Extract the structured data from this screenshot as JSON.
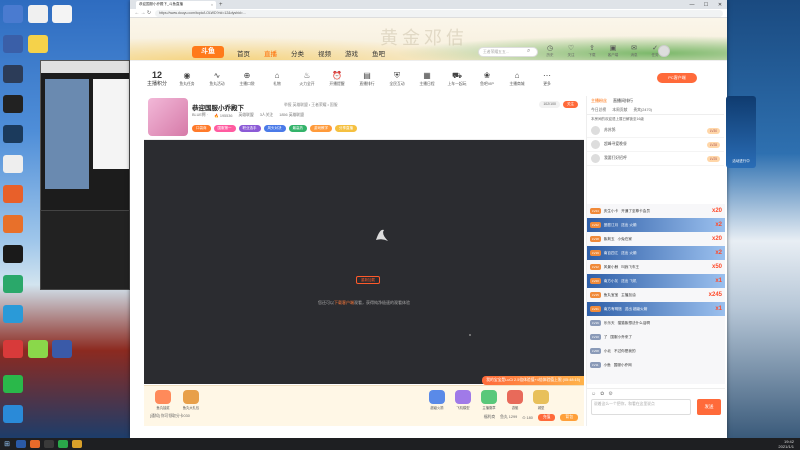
{
  "browser": {
    "tab_title": "恭迎国服小乔殿下_斗鱼直播",
    "url": "https://www.douyu.com/topic/LOLWD?rid=12&dyshid=...",
    "win_min": "—",
    "win_max": "☐",
    "win_close": "✕"
  },
  "site": {
    "watermark": "黄金邓佶",
    "logo": "斗鱼",
    "nav": [
      "首页",
      "直播",
      "分类",
      "视频",
      "游戏",
      "鱼吧"
    ],
    "nav_active_index": 1,
    "search_placeholder": "王者荣耀五五...",
    "header_icons": [
      {
        "icon": "history-icon",
        "glyph": "◷",
        "label": "历史"
      },
      {
        "icon": "follow-icon",
        "glyph": "♡",
        "label": "关注"
      },
      {
        "icon": "upload-icon",
        "glyph": "⇪",
        "label": "下载"
      },
      {
        "icon": "app-icon",
        "glyph": "▣",
        "label": "客户端"
      },
      {
        "icon": "message-icon",
        "glyph": "✉",
        "label": "消息"
      },
      {
        "icon": "task-icon",
        "glyph": "✓",
        "label": "任务"
      }
    ]
  },
  "categories": {
    "first_value": "12",
    "first_label": "主播积分",
    "items": [
      {
        "icon": "game-icon",
        "glyph": "◉",
        "label": "鱼丸任务"
      },
      {
        "icon": "pulse-icon",
        "glyph": "∿",
        "label": "鱼丸活动"
      },
      {
        "icon": "capsule-icon",
        "glyph": "⊕",
        "label": "主播口袋"
      },
      {
        "icon": "gift-icon",
        "glyph": "⌂",
        "label": "礼物"
      },
      {
        "icon": "fire-icon",
        "glyph": "♨",
        "label": "火力全开"
      },
      {
        "icon": "clock-icon",
        "glyph": "⏰",
        "label": "开播提醒"
      },
      {
        "icon": "chart-icon",
        "glyph": "▤",
        "label": "直播排行"
      },
      {
        "icon": "shield-icon",
        "glyph": "⛨",
        "label": "全民互动"
      },
      {
        "icon": "calendar-icon",
        "glyph": "▦",
        "label": "主播日程"
      },
      {
        "icon": "car-icon",
        "glyph": "⛟",
        "label": "上车一起玩"
      },
      {
        "icon": "fish-icon",
        "glyph": "❀",
        "label": "鱼吧VIP"
      },
      {
        "icon": "shop-icon",
        "glyph": "⌂",
        "label": "主播商城"
      },
      {
        "icon": "more-icon",
        "glyph": "⋯",
        "label": "更多"
      }
    ],
    "pc_button": "PC客户端"
  },
  "room": {
    "title": "恭迎国服小乔殿下",
    "meta": "举报   英雄联盟 • 王者荣耀 • 国服",
    "stats": [
      "BLUE鳄 ·",
      "🔥 195536",
      "英雄联盟",
      "3人关注",
      "1856 英雄联盟"
    ],
    "badges": [
      {
        "text": "口袋商",
        "color": "#ff7a2a"
      },
      {
        "text": "国服第一",
        "color": "#ff5ba0"
      },
      {
        "text": "职业选手",
        "color": "#8b5ad6"
      },
      {
        "text": "风头对决",
        "color": "#4a7ae8"
      },
      {
        "text": "最高热",
        "color": "#33b36a"
      },
      {
        "text": "游戏教学",
        "color": "#ff9a3a"
      },
      {
        "text": "分享直播",
        "color": "#f5c040"
      }
    ],
    "right_pills": [
      "102/100",
      "关注"
    ],
    "reload_label": "重新加载",
    "tip_prefix": "您还可以",
    "tip_link": "下载客户端",
    "tip_suffix": "观看，获得纯净极速的观看体验",
    "promo": "我的宝宝是LuCi  2.5倍体验值+4倍体验值上限 (05:48:15)",
    "gifts": [
      {
        "name": "鱼丸抽奖",
        "color": "#ff8a5a"
      },
      {
        "name": "鱼丸大礼包",
        "color": "#e8a04a"
      },
      {
        "name": "超级火箭",
        "color": "#5a8ae8"
      },
      {
        "name": "飞机模型",
        "color": "#a07ae8"
      },
      {
        "name": "主播徽章",
        "color": "#5ac87a"
      },
      {
        "name": "游艇",
        "color": "#e86a5a"
      },
      {
        "name": "城堡",
        "color": "#e8c05a"
      }
    ],
    "gift_bar_left": "[通知] 你可领取分卡030",
    "gift_bar_right_items": [
      "福利商",
      "鱼丸 1299",
      "⊙ 180"
    ],
    "gift_bar_buttons": [
      "充值",
      "背包"
    ]
  },
  "sidebar": {
    "tabs": [
      "主播粉丝",
      "直播间排行"
    ],
    "subtabs": [
      "今日总榜",
      "本周贡献",
      "贵宾(2470)"
    ],
    "notice": "本房间的欢迎语上展已解锁至16级",
    "rank_rows": [
      {
        "name": "苏苏鸽",
        "level": "LV30"
      },
      {
        "name": "超峰寻爱晚餐",
        "level": "LV28"
      },
      {
        "name": "我要打好招呼",
        "level": "LV25"
      }
    ],
    "chat": [
      {
        "user": "庆生小卡",
        "tag": "LV24",
        "text": "开通了至尊卡会员",
        "big": "x20",
        "hl": false
      },
      {
        "user": "曼庭江月",
        "tag": "LV22",
        "text": "送出 火箭",
        "big": "x2",
        "hl": true
      },
      {
        "user": "紫荆玉",
        "tag": "LV18",
        "text": "小兔在家",
        "big": "x20",
        "hl": false
      },
      {
        "user": "南百四江",
        "tag": "LV19",
        "text": "送出 火箭",
        "big": "x2",
        "hl": true
      },
      {
        "user": "风景小鲸",
        "tag": "LV12",
        "text": "叫我飞车王",
        "big": "x50",
        "hl": false
      },
      {
        "user": "南方小灰",
        "tag": "LV20",
        "text": "送出 飞机",
        "big": "x1",
        "hl": true
      },
      {
        "user": "鱼丸宝宝",
        "tag": "LV15",
        "text": "主播加油",
        "big": "x245",
        "hl": false
      },
      {
        "user": "南方有明馆",
        "tag": "LV21",
        "text": "送出 超级火箭",
        "big": "x1",
        "hl": true
      },
      {
        "user": "乐乐天",
        "tag": "LV16",
        "text": "猫猫紫想法什么话啊",
        "big": "",
        "hl": false
      },
      {
        "user": "了",
        "tag": "LV10",
        "text": "国服小乔来了",
        "big": "",
        "hl": false
      },
      {
        "user": "小北",
        "tag": "LV08",
        "text": "不过你是我的",
        "big": "",
        "hl": false
      },
      {
        "user": "小鱼",
        "tag": "LV11",
        "text": "国服小乔网",
        "big": "",
        "hl": false
      }
    ],
    "input_placeholder": "说着这么一个把你，和看在这里说点",
    "send_label": "发送",
    "float_label": "活动进行中"
  },
  "taskbar": {
    "clock_time": "19:42",
    "clock_date": "2021/1/1"
  }
}
